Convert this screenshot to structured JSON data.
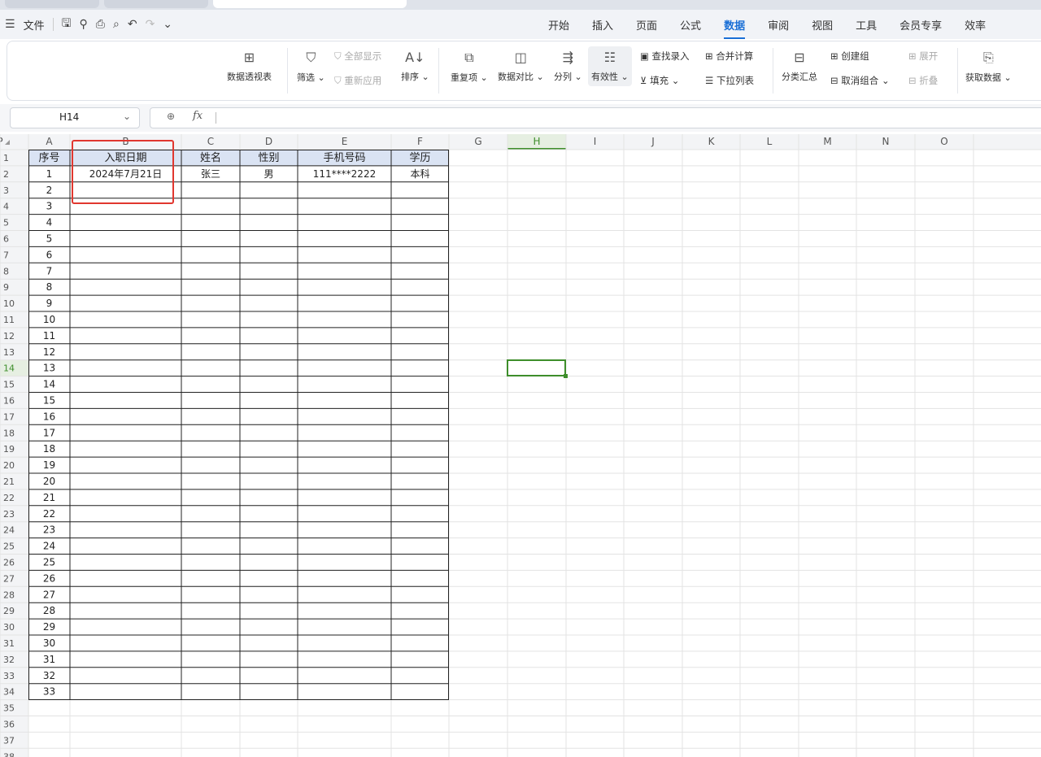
{
  "menu": {
    "hamburger_icon": "menu-icon",
    "file_label": "文件",
    "quick_icons": [
      "save-icon",
      "share-icon",
      "print-icon",
      "print-preview-icon",
      "undo-icon",
      "redo-icon",
      "more-icon"
    ],
    "tabs": [
      {
        "label": "开始",
        "active": false
      },
      {
        "label": "插入",
        "active": false
      },
      {
        "label": "页面",
        "active": false
      },
      {
        "label": "公式",
        "active": false
      },
      {
        "label": "数据",
        "active": true
      },
      {
        "label": "审阅",
        "active": false
      },
      {
        "label": "视图",
        "active": false
      },
      {
        "label": "工具",
        "active": false
      },
      {
        "label": "会员专享",
        "active": false
      },
      {
        "label": "效率",
        "active": false
      }
    ]
  },
  "ribbon": {
    "pivot": "数据透视表",
    "filter": "筛选",
    "show_all": "全部显示",
    "reapply": "重新应用",
    "sort": "排序",
    "duplicates": "重复项",
    "compare": "数据对比",
    "split": "分列",
    "validity": "有效性",
    "lookup": "查找录入",
    "fill": "填充",
    "consolidate": "合并计算",
    "dropdown": "下拉列表",
    "subtotal": "分类汇总",
    "create_group": "创建组",
    "ungroup": "取消组合",
    "expand": "展开",
    "collapse": "折叠",
    "get_data": "获取数据"
  },
  "formula_bar": {
    "cell_ref": "H14",
    "fx": "fx",
    "value": ""
  },
  "columns": [
    "A",
    "B",
    "C",
    "D",
    "E",
    "F",
    "G",
    "H",
    "I",
    "J",
    "K",
    "L",
    "M",
    "N",
    "O",
    "P"
  ],
  "active_column": "H",
  "active_row": 14,
  "header_row": [
    "序号",
    "入职日期",
    "姓名",
    "性别",
    "手机号码",
    "学历"
  ],
  "first_data_row": [
    "1",
    "2024年7月21日",
    "张三",
    "男",
    "111****2222",
    "本科"
  ],
  "row_count": 38,
  "serial_max": 33,
  "colors": {
    "accent": "#1a6fd6",
    "header_fill": "#dae3f3",
    "selection": "#3e8e2b",
    "highlight_box": "#e1372f"
  }
}
